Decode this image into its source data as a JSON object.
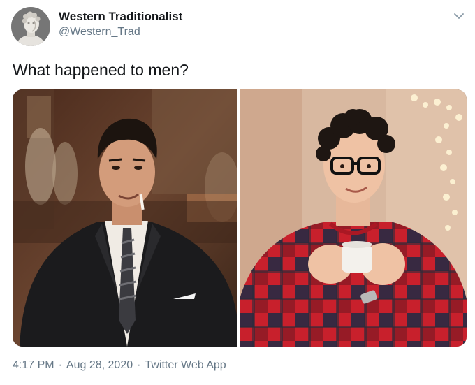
{
  "author": {
    "display_name": "Western Traditionalist",
    "handle": "@Western_Trad",
    "avatar_icon": "marble-bust-avatar"
  },
  "menu_icon": "chevron-down-icon",
  "tweet": {
    "text": "What happened to men?"
  },
  "media": {
    "count": 2,
    "photos": [
      {
        "subject": "man-in-suit-photo"
      },
      {
        "subject": "man-in-plaid-pajamas-photo"
      }
    ]
  },
  "meta": {
    "time": "4:17 PM",
    "separator": "·",
    "date": "Aug 28, 2020",
    "source": "Twitter Web App"
  },
  "colors": {
    "primary_text": "#14171a",
    "secondary_text": "#657786",
    "background": "#ffffff"
  }
}
